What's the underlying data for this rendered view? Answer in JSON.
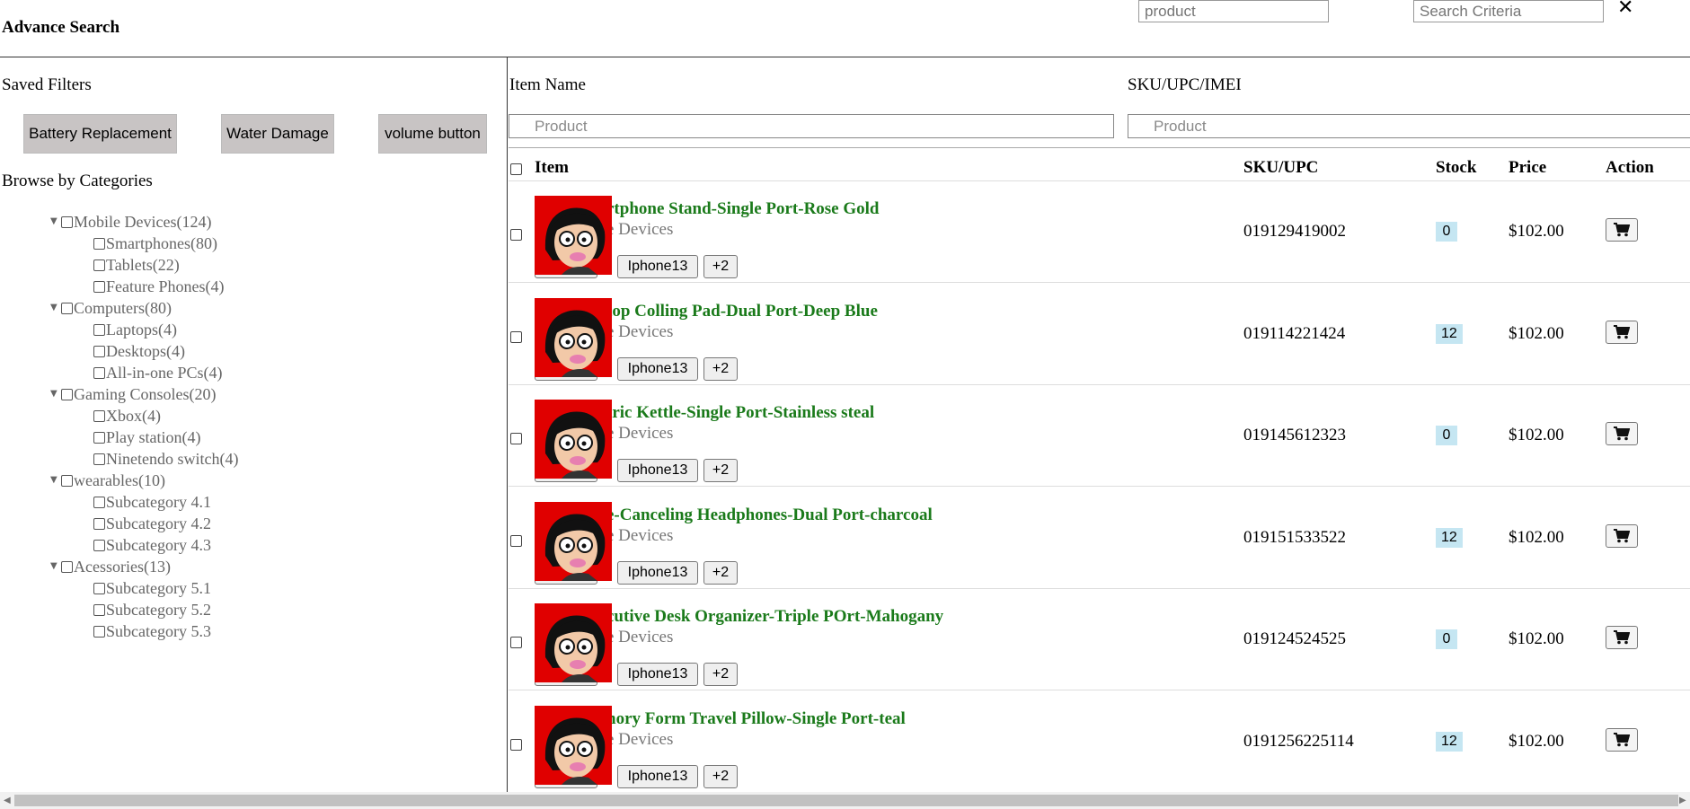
{
  "header": {
    "title": "Advance Search",
    "product_placeholder": "product",
    "criteria_placeholder": "Search Criteria",
    "close_icon": "✕"
  },
  "sidebar": {
    "saved_filters_title": "Saved Filters",
    "saved_filters": [
      "Battery Replacement",
      "Water Damage",
      "volume button"
    ],
    "browse_title": "Browse by Categories",
    "categories": [
      {
        "label": "Mobile Devices(124)",
        "children": [
          "Smartphones(80)",
          "Tablets(22)",
          "Feature Phones(4)"
        ]
      },
      {
        "label": "Computers(80)",
        "children": [
          "Laptops(4)",
          "Desktops(4)",
          "All-in-one PCs(4)"
        ]
      },
      {
        "label": "Gaming Consoles(20)",
        "children": [
          "Xbox(4)",
          "Play station(4)",
          "Ninetendo switch(4)"
        ]
      },
      {
        "label": "wearables(10)",
        "children": [
          "Subcategory 4.1",
          "Subcategory 4.2",
          "Subcategory 4.3"
        ]
      },
      {
        "label": "Acessories(13)",
        "children": [
          "Subcategory 5.1",
          "Subcategory 5.2",
          "Subcategory 5.3"
        ]
      }
    ]
  },
  "main": {
    "item_name_label": "Item Name",
    "sku_label": "SKU/UPC/IMEI",
    "item_name_placeholder": "Product",
    "sku_placeholder": "Product",
    "columns": {
      "item": "Item",
      "sku": "SKU/UPC",
      "stock": "Stock",
      "price": "Price",
      "action": "Action"
    },
    "rows": [
      {
        "name": "rtphone Stand-Single Port-Rose Gold",
        "category": "e Devices",
        "tag1": "Iphone13",
        "tag2": "+2",
        "sku": "019129419002",
        "stock": "0",
        "price": "$102.00"
      },
      {
        "name": "top Colling Pad-Dual Port-Deep Blue",
        "category": "e Devices",
        "tag1": "Iphone13",
        "tag2": "+2",
        "sku": "019114221424",
        "stock": "12",
        "price": "$102.00"
      },
      {
        "name": "tric Kettle-Single Port-Stainless steal",
        "category": "e Devices",
        "tag1": "Iphone13",
        "tag2": "+2",
        "sku": "019145612323",
        "stock": "0",
        "price": "$102.00"
      },
      {
        "name": "e-Canceling Headphones-Dual Port-charcoal",
        "category": "e Devices",
        "tag1": "Iphone13",
        "tag2": "+2",
        "sku": "019151533522",
        "stock": "12",
        "price": "$102.00"
      },
      {
        "name": "cutive Desk Organizer-Triple POrt-Mahogany",
        "category": "e Devices",
        "tag1": "Iphone13",
        "tag2": "+2",
        "sku": "019124524525",
        "stock": "0",
        "price": "$102.00"
      },
      {
        "name": "nory Form Travel Pillow-Single Port-teal",
        "category": "e Devices",
        "tag1": "Iphone13",
        "tag2": "+2",
        "sku": "0191256225114",
        "stock": "12",
        "price": "$102.00"
      }
    ]
  },
  "colors": {
    "item_name": "#1a7a1a",
    "stock_badge": "#c5e6f2",
    "chip_bg": "#c8c4c4",
    "thumb_bg": "#e00000"
  },
  "icons": {
    "cart": "cart-icon",
    "close": "close-icon",
    "caret": "caret-down-icon"
  }
}
